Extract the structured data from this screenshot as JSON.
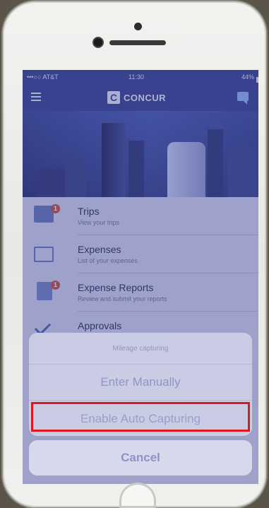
{
  "status_bar": {
    "carrier": "•••○○ AT&T",
    "time": "11:30",
    "battery": "44%"
  },
  "header": {
    "logo_text": "CONCUR",
    "logo_mark": "C"
  },
  "menu": [
    {
      "title": "Trips",
      "subtitle": "View your trips",
      "badge": "1",
      "icon": "trips-icon"
    },
    {
      "title": "Expenses",
      "subtitle": "List of your expenses",
      "icon": "credit-card-icon"
    },
    {
      "title": "Expense Reports",
      "subtitle": "Review and submit your reports",
      "badge": "1",
      "icon": "report-icon"
    },
    {
      "title": "Approvals",
      "icon": "checkmark-icon"
    }
  ],
  "action_sheet": {
    "title": "Mileage capturing",
    "option_manual": "Enter Manually",
    "option_auto": "Enable Auto Capturing",
    "cancel": "Cancel"
  },
  "colors": {
    "brand": "#2f3a8c",
    "highlight_box": "#e2161d"
  }
}
